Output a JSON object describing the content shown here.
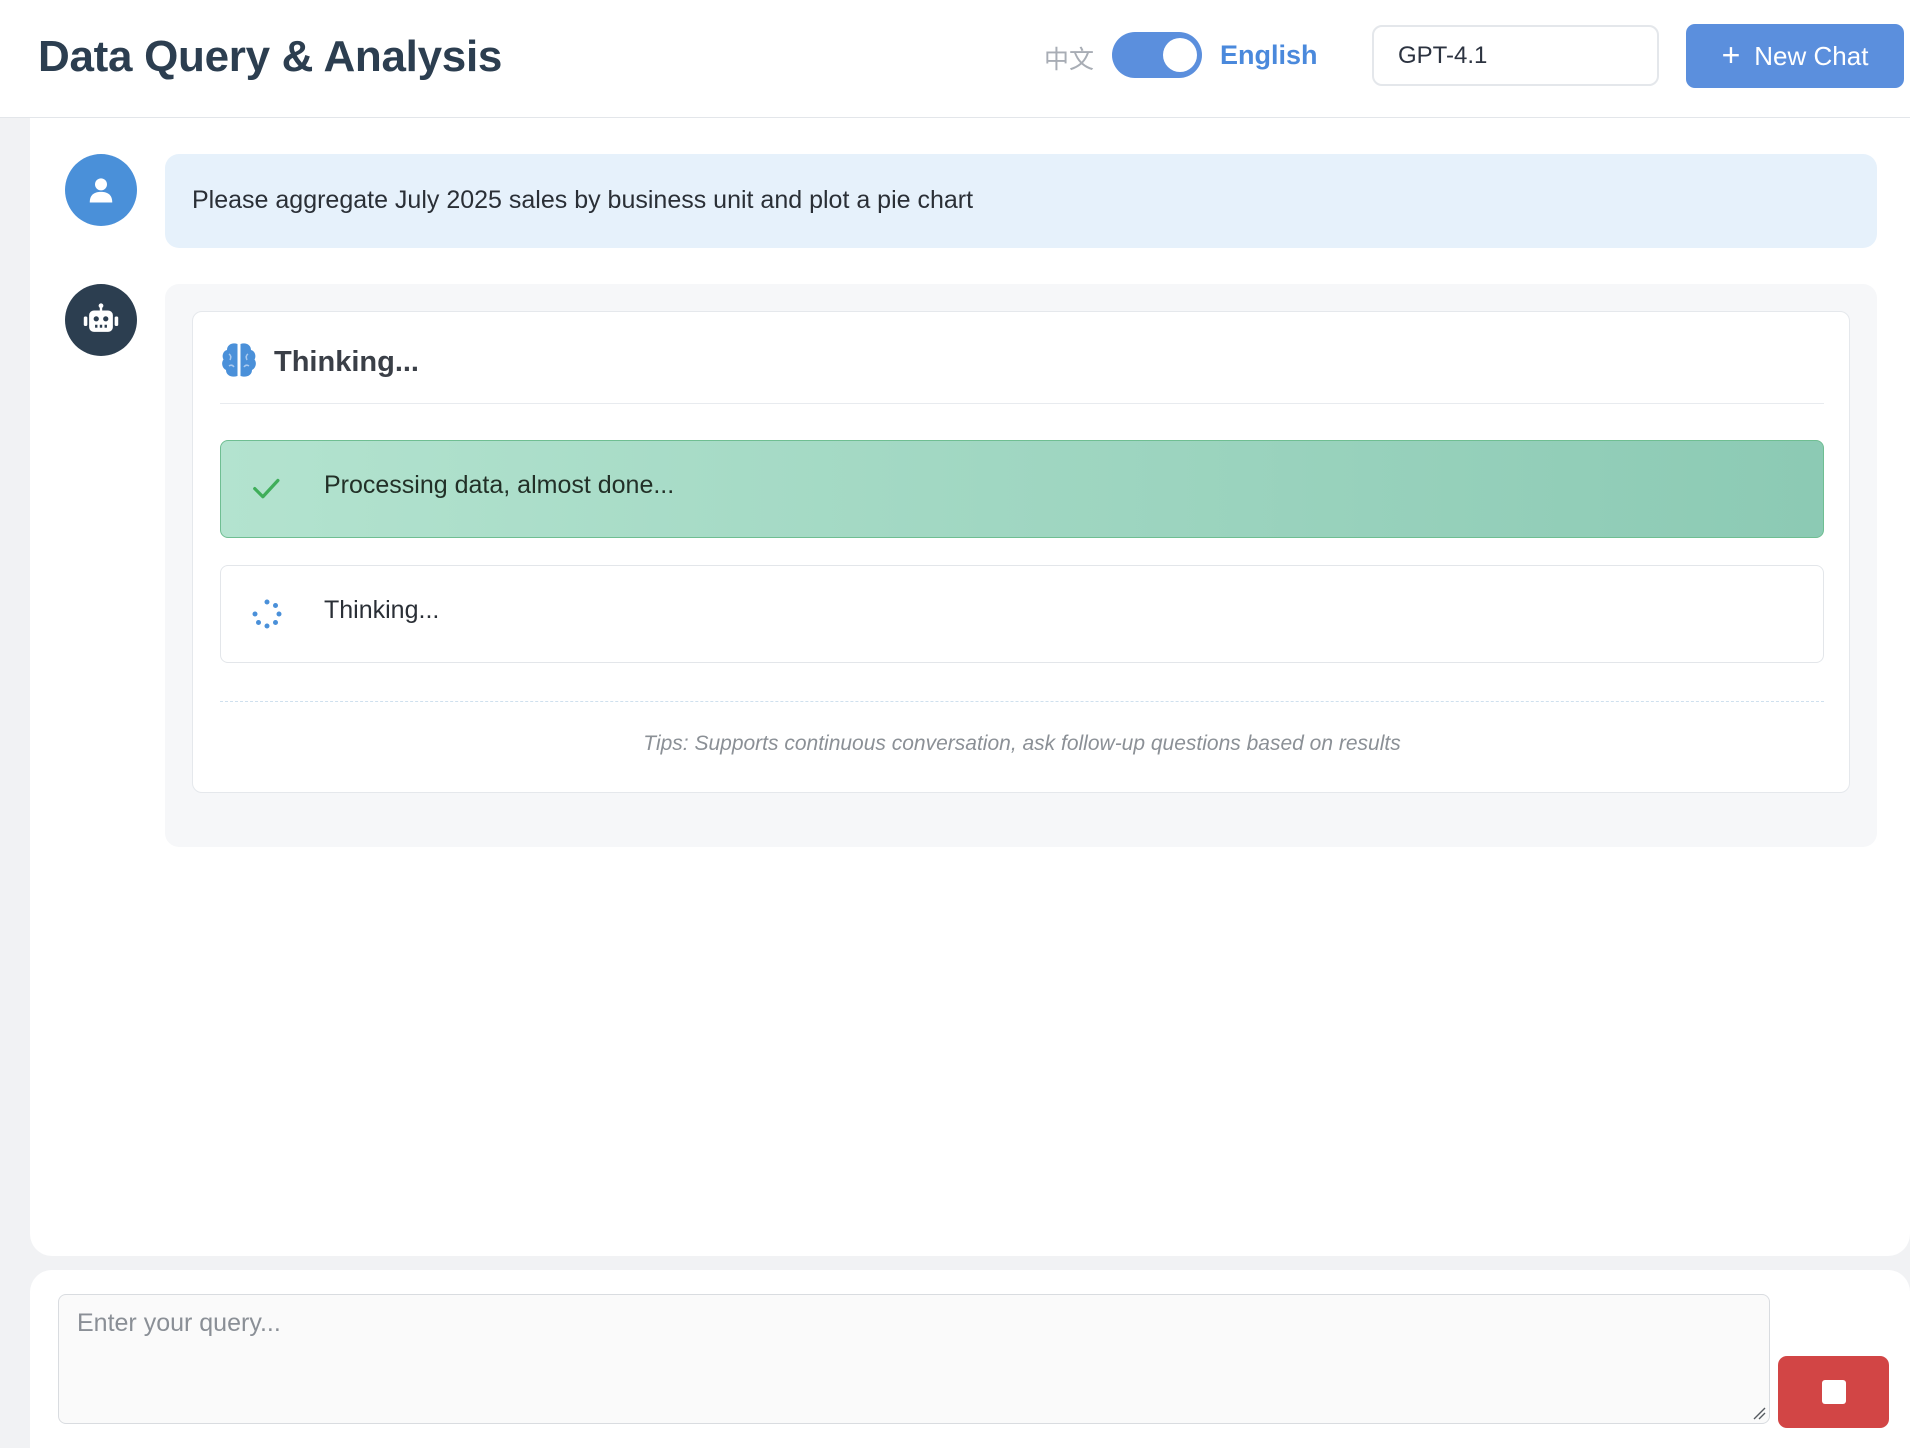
{
  "header": {
    "title": "Data Query & Analysis",
    "lang_zh": "中文",
    "lang_en": "English",
    "model": "GPT-4.1",
    "new_chat_label": "New Chat"
  },
  "chat": {
    "user_message": "Please aggregate July 2025 sales by business unit and plot a pie chart",
    "thinking_title": "Thinking...",
    "steps": [
      {
        "label": "Processing data, almost done...",
        "status": "done",
        "icon": "check-icon"
      },
      {
        "label": "Thinking...",
        "status": "in-progress",
        "icon": "spinner-icon"
      }
    ],
    "tips": "Tips: Supports continuous conversation, ask follow-up questions based on results"
  },
  "input": {
    "placeholder": "Enter your query...",
    "value": ""
  },
  "icons": {
    "user_avatar": "user-icon",
    "bot_avatar": "robot-icon",
    "thinking": "brain-icon",
    "new_chat": "plus-icon",
    "stop": "stop-icon"
  },
  "colors": {
    "accent": "#4a90d9",
    "button_blue": "#5b8fdd",
    "bot_avatar": "#2c3e50",
    "user_bubble": "#e6f1fb",
    "success_green": "#9ed8c2",
    "check_green": "#3fae5a",
    "stop_red": "#d24545"
  }
}
